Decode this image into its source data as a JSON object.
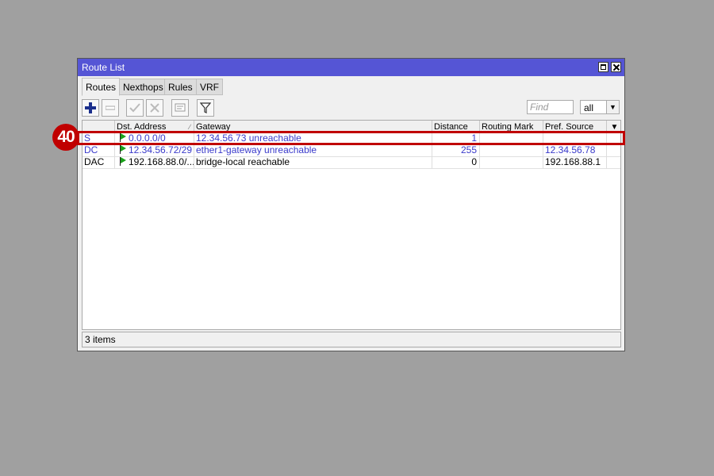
{
  "window": {
    "title": "Route List"
  },
  "tabs": [
    {
      "label": "Routes",
      "active": true
    },
    {
      "label": "Nexthops",
      "active": false
    },
    {
      "label": "Rules",
      "active": false
    },
    {
      "label": "VRF",
      "active": false
    }
  ],
  "toolbar": {
    "add_icon": "plus-icon",
    "remove_icon": "minus-icon",
    "enable_icon": "check-icon",
    "disable_icon": "x-icon",
    "comment_icon": "comment-icon",
    "filter_icon": "filter-icon",
    "find_placeholder": "Find",
    "filter_value": "all"
  },
  "table": {
    "columns": [
      "",
      "Dst. Address",
      "Gateway",
      "Distance",
      "Routing Mark",
      "Pref. Source"
    ],
    "rows": [
      {
        "flags": "S",
        "dst": "0.0.0.0/0",
        "gateway": "12.34.56.73 unreachable",
        "distance": "1",
        "routing_mark": "",
        "pref_source": "",
        "color": "#3a3acb"
      },
      {
        "flags": "DC",
        "dst": "12.34.56.72/29",
        "gateway": "ether1-gateway unreachable",
        "distance": "255",
        "routing_mark": "",
        "pref_source": "12.34.56.78",
        "color": "#3a3acb"
      },
      {
        "flags": "DAC",
        "dst": "192.168.88.0/...",
        "gateway": "bridge-local reachable",
        "distance": "0",
        "routing_mark": "",
        "pref_source": "192.168.88.1",
        "color": "#000000"
      }
    ]
  },
  "status": {
    "items": "3 items"
  },
  "annotation": {
    "badge": "40",
    "color": "#c00000"
  }
}
